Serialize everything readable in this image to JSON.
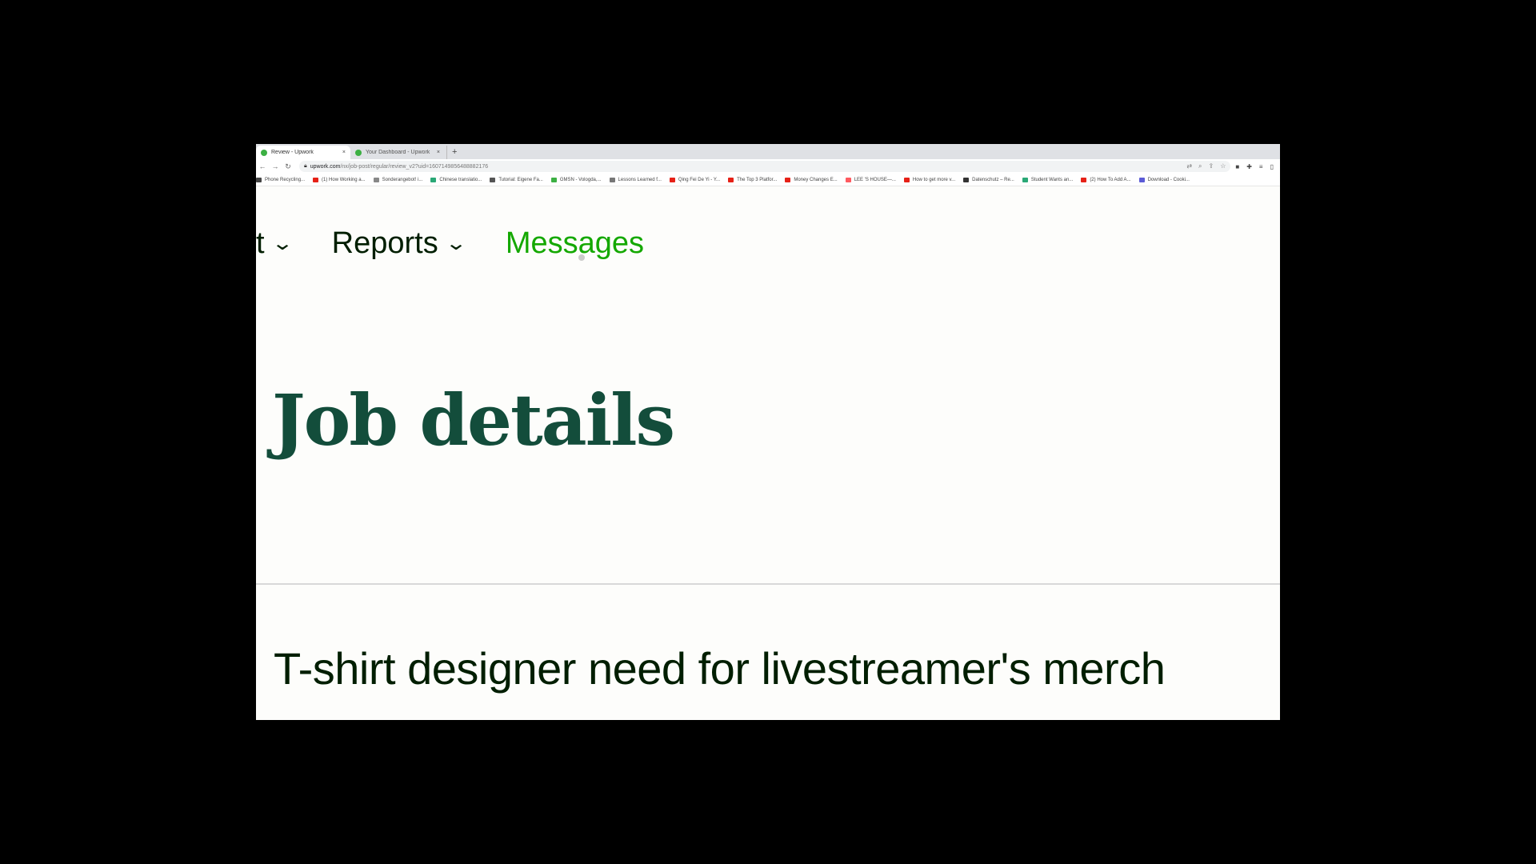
{
  "browser": {
    "tabs": [
      {
        "label": "Review - Upwork",
        "active": true
      },
      {
        "label": "Your Dashboard - Upwork",
        "active": false
      }
    ],
    "new_tab_label": "+",
    "close_label": "×",
    "address": {
      "host": "upwork.com",
      "path": "/nx/job-post/regular/review_v2?uid=1607149856488882176"
    },
    "bookmarks": [
      {
        "label": "Phone Recycling...",
        "color": "#444444"
      },
      {
        "label": "(1) How Working a...",
        "color": "#e62117"
      },
      {
        "label": "Sonderangebot! i...",
        "color": "#888888"
      },
      {
        "label": "Chinese translatio...",
        "color": "#2aa876"
      },
      {
        "label": "Tutorial: Eigene Fa...",
        "color": "#555555"
      },
      {
        "label": "GMSN - Vologda,...",
        "color": "#3cb043"
      },
      {
        "label": "Lessons Learned f...",
        "color": "#777777"
      },
      {
        "label": "Qing Fei De Yi - Y...",
        "color": "#e62117"
      },
      {
        "label": "The Top 3 Platfor...",
        "color": "#e62117"
      },
      {
        "label": "Money Changes E...",
        "color": "#e62117"
      },
      {
        "label": "LEE 'S HOUSE—...",
        "color": "#ff5a5f"
      },
      {
        "label": "How to get more v...",
        "color": "#e62117"
      },
      {
        "label": "Datenschutz – Re...",
        "color": "#333333"
      },
      {
        "label": "Student Wants an...",
        "color": "#2aa876"
      },
      {
        "label": "(2) How To Add A...",
        "color": "#e62117"
      },
      {
        "label": "Download - Cooki...",
        "color": "#5b5bd6"
      }
    ]
  },
  "nav": {
    "items": [
      {
        "label": "t",
        "has_dropdown": true
      },
      {
        "label": "Reports",
        "has_dropdown": true
      },
      {
        "label": "Messages",
        "has_dropdown": false
      }
    ],
    "chevron": "⌄",
    "active_color": "#14a800"
  },
  "page": {
    "title": "Job details",
    "job_title": "T-shirt designer need for livestreamer's merch"
  }
}
